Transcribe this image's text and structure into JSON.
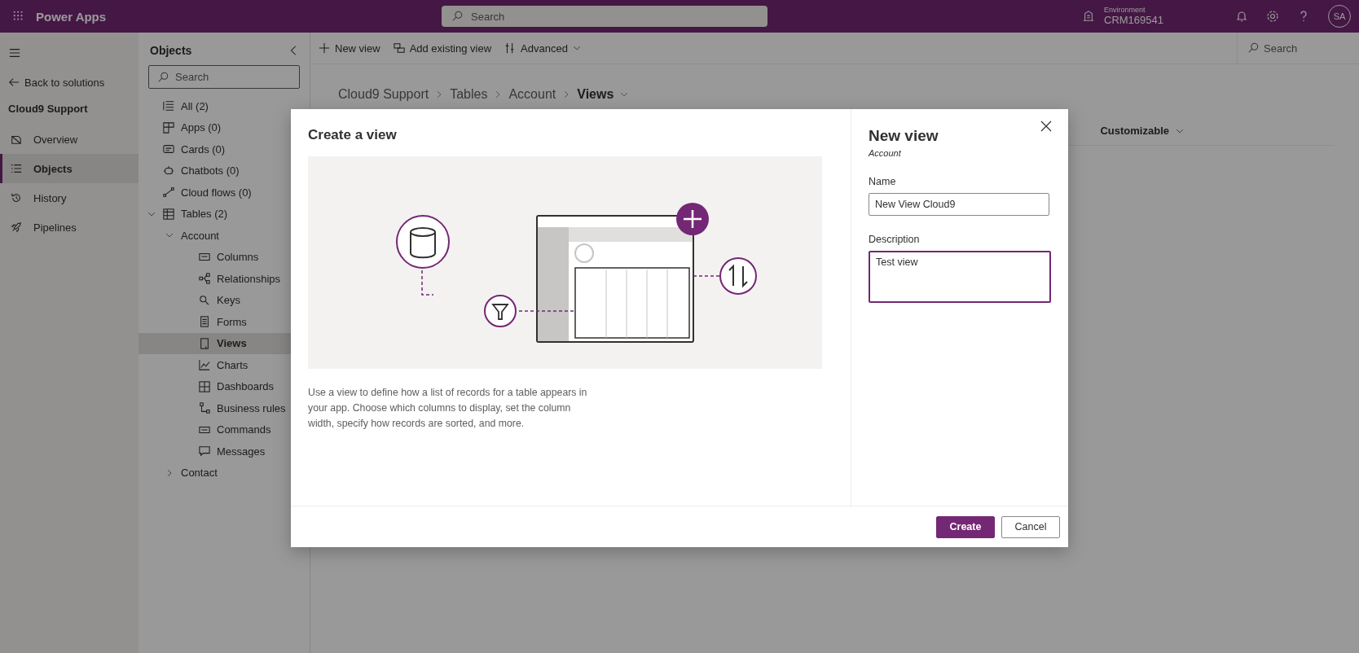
{
  "app_bar": {
    "app_name": "Power Apps",
    "search": {
      "placeholder": "Search"
    },
    "environment": {
      "label": "Environment",
      "value": "CRM169541"
    },
    "avatar": "SA"
  },
  "nav": {
    "back": "Back to solutions",
    "solution": "Cloud9 Support",
    "items": [
      {
        "label": "Overview",
        "kind": "overview",
        "selected": false
      },
      {
        "label": "Objects",
        "kind": "objects",
        "selected": true
      },
      {
        "label": "History",
        "kind": "history",
        "selected": false
      },
      {
        "label": "Pipelines",
        "kind": "pipelines",
        "selected": false
      }
    ]
  },
  "objects": {
    "title": "Objects",
    "search": {
      "placeholder": "Search"
    },
    "tree": [
      {
        "label": "All",
        "count": "(2)",
        "kind": "all",
        "selected": false
      },
      {
        "label": "Apps",
        "count": "(0)",
        "kind": "apps",
        "selected": false
      },
      {
        "label": "Cards",
        "count": "(0)",
        "kind": "cards",
        "selected": false
      },
      {
        "label": "Chatbots",
        "count": "(0)",
        "kind": "chatbots",
        "selected": false
      },
      {
        "label": "Cloud flows",
        "count": "(0)",
        "kind": "flows",
        "selected": false
      },
      {
        "label": "Tables",
        "count": "(2)",
        "kind": "tables",
        "selected": false,
        "expanded": true,
        "children": [
          {
            "label": "Account",
            "selected": false,
            "expanded": true,
            "children": [
              {
                "label": "Columns",
                "kind": "columns",
                "selected": false
              },
              {
                "label": "Relationships",
                "kind": "relationships",
                "selected": false
              },
              {
                "label": "Keys",
                "kind": "keys",
                "selected": false
              },
              {
                "label": "Forms",
                "kind": "forms",
                "selected": false
              },
              {
                "label": "Views",
                "kind": "views",
                "selected": true
              },
              {
                "label": "Charts",
                "kind": "charts",
                "selected": false
              },
              {
                "label": "Dashboards",
                "kind": "dashboards",
                "selected": false
              },
              {
                "label": "Business rules",
                "kind": "rules",
                "selected": false
              },
              {
                "label": "Commands",
                "kind": "commands",
                "selected": false
              },
              {
                "label": "Messages",
                "kind": "messages",
                "selected": false
              }
            ]
          },
          {
            "label": "Contact",
            "selected": false,
            "expanded": false
          }
        ]
      }
    ]
  },
  "command_bar": {
    "buttons": [
      {
        "label": "New view",
        "kind": "add"
      },
      {
        "label": "Add existing view",
        "kind": "existing"
      },
      {
        "label": "Advanced",
        "kind": "advanced"
      }
    ],
    "search": {
      "placeholder": "Search"
    }
  },
  "breadcrumb": [
    {
      "label": "Cloud9 Support",
      "current": false
    },
    {
      "label": "Tables",
      "current": false
    },
    {
      "label": "Account",
      "current": false
    },
    {
      "label": "Views",
      "current": true
    }
  ],
  "column_header": "Customizable",
  "dialog": {
    "title": "Create a view",
    "description": "Use a view to define how a list of records for a table appears in your app. Choose which columns to display, set the column width, specify how records are sorted, and more.",
    "panel": {
      "title": "New view",
      "subtitle": "Account",
      "fields": [
        {
          "label": "Name",
          "value": "New View Cloud9",
          "kind": "input",
          "focused": false
        },
        {
          "label": "Description",
          "value": "Test view",
          "kind": "textarea",
          "focused": true
        }
      ]
    },
    "buttons": [
      {
        "label": "Create",
        "kind": "primary"
      },
      {
        "label": "Cancel",
        "kind": "secondary"
      }
    ]
  }
}
